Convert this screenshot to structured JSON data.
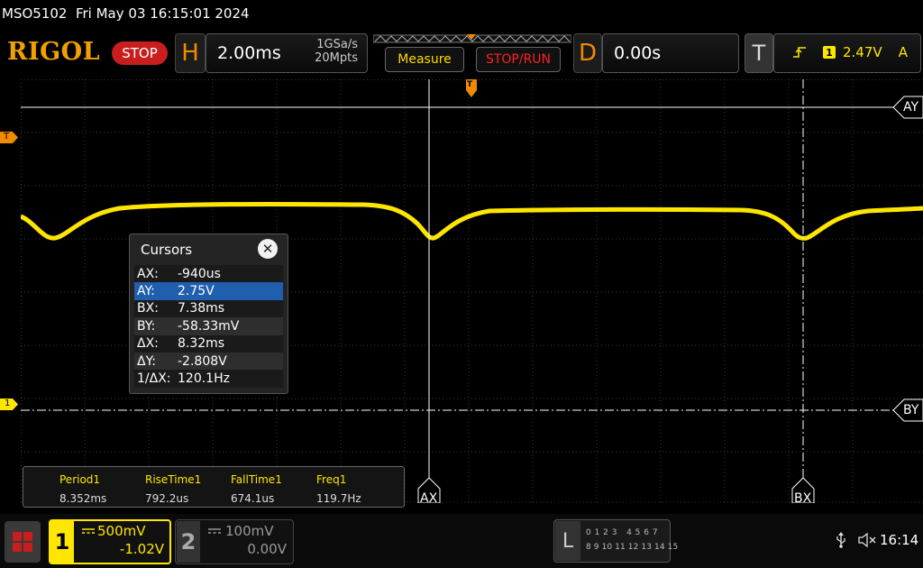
{
  "status_line": "MSO5102  Fri May 03 16:15:01 2024",
  "brand": "RIGOL",
  "run_state": "STOP",
  "horizontal": {
    "letter": "H",
    "scale": "2.00ms",
    "sample_rate": "1GSa/s",
    "memory_depth": "20Mpts"
  },
  "buttons": {
    "measure": "Measure",
    "stop_run": "STOP/RUN"
  },
  "delay": {
    "letter": "D",
    "value": "0.00s"
  },
  "trigger": {
    "letter": "T",
    "source": "1",
    "level": "2.47V",
    "mode": "A",
    "edge_icon": "rising-edge-icon"
  },
  "markers": {
    "trigger_level": "T",
    "channel1": "1",
    "ay": "AY",
    "by": "BY",
    "ax": "AX",
    "bx": "BX"
  },
  "cursors": {
    "title": "Cursors",
    "close_icon": "close-icon",
    "rows": [
      {
        "label": "AX:",
        "value": "-940us",
        "selected": false
      },
      {
        "label": "AY:",
        "value": "2.75V",
        "selected": true
      },
      {
        "label": "BX:",
        "value": "7.38ms",
        "selected": false
      },
      {
        "label": "BY:",
        "value": "-58.33mV",
        "selected": false
      },
      {
        "label": "ΔX:",
        "value": "8.32ms",
        "selected": false
      },
      {
        "label": "ΔY:",
        "value": "-2.808V",
        "selected": false
      },
      {
        "label": "1/ΔX:",
        "value": "120.1Hz",
        "selected": false
      }
    ]
  },
  "measurements": [
    {
      "name": "Period1",
      "value": "8.352ms"
    },
    {
      "name": "RiseTime1",
      "value": "792.2us"
    },
    {
      "name": "FallTime1",
      "value": "674.1us"
    },
    {
      "name": "Freq1",
      "value": "119.7Hz"
    }
  ],
  "channels": [
    {
      "number": "1",
      "scale": "500mV",
      "offset": "-1.02V",
      "active": true,
      "color": "#ffe600"
    },
    {
      "number": "2",
      "scale": "100mV",
      "offset": "0.00V",
      "active": false,
      "color": "#999999"
    }
  ],
  "logic_analyzer": {
    "letter": "L",
    "row1": "0 1 2 3   4 5 6 7",
    "row2": "8 9 10 11 12 13 14 15"
  },
  "system": {
    "usb_icon": "usb-icon",
    "mute_icon": "speaker-mute-icon",
    "time": "16:14"
  },
  "colors": {
    "trace": "#ffe600",
    "brand": "#f0a000",
    "stop": "#c81e1e",
    "accent_orange": "#f08a00",
    "selection": "#1f5fae"
  }
}
